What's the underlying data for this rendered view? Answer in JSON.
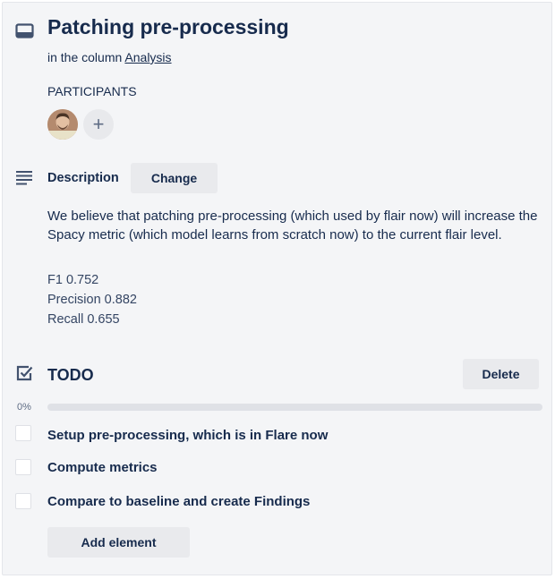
{
  "card": {
    "title": "Patching pre-processing",
    "column_prefix": "in the column",
    "column_name": "Analysis"
  },
  "participants": {
    "label": "PARTICIPANTS",
    "add_symbol": "+"
  },
  "description": {
    "label": "Description",
    "change_label": "Change",
    "text": "We believe that patching pre-processing (which used by flair now) will increase the Spacy metric (which model learns from scratch now) to the current flair level.",
    "metrics": [
      "F1 0.752",
      "Precision 0.882",
      "Recall 0.655"
    ]
  },
  "checklist": {
    "title": "TODO",
    "delete_label": "Delete",
    "progress_text": "0%",
    "progress_value": 0,
    "items": [
      {
        "label": "Setup pre-processing, which is in Flare now",
        "checked": false
      },
      {
        "label": "Compute metrics",
        "checked": false
      },
      {
        "label": "Compare to baseline and create Findings",
        "checked": false
      }
    ],
    "add_label": "Add element"
  },
  "icons": {
    "card": "card-icon",
    "description": "description-icon",
    "checklist": "checklist-icon"
  },
  "colors": {
    "text": "#172b4d",
    "background": "#f4f5f7",
    "button": "#e9eaed",
    "progress_track": "#dfe1e6"
  }
}
